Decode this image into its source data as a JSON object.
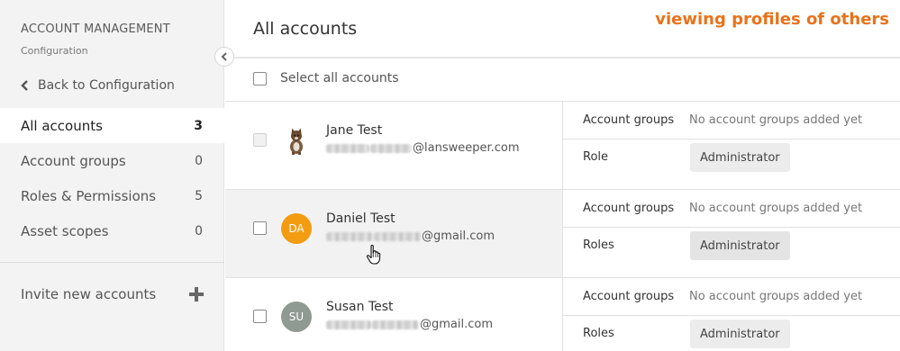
{
  "sidebar": {
    "title": "ACCOUNT MANAGEMENT",
    "subtitle": "Configuration",
    "back_label": "Back to Configuration",
    "items": [
      {
        "label": "All accounts",
        "count": "3",
        "active": true
      },
      {
        "label": "Account groups",
        "count": "0",
        "active": false
      },
      {
        "label": "Roles & Permissions",
        "count": "5",
        "active": false
      },
      {
        "label": "Asset scopes",
        "count": "0",
        "active": false
      }
    ],
    "invite_label": "Invite new accounts"
  },
  "main": {
    "title": "All accounts",
    "annotation": "viewing profiles of others",
    "select_all_label": "Select all accounts",
    "accounts": [
      {
        "name": "Jane Test",
        "email_domain": "@lansweeper.com",
        "avatar": "cat-photo",
        "initials": "",
        "avatar_color": "",
        "checkbox_disabled": true,
        "groups_label": "Account groups",
        "groups_value": "No account groups added yet",
        "role_label": "Role",
        "role_value": "Administrator"
      },
      {
        "name": "Daniel Test",
        "email_domain": "@gmail.com",
        "avatar": "initials",
        "initials": "DA",
        "avatar_color": "#f39c12",
        "checkbox_disabled": false,
        "groups_label": "Account groups",
        "groups_value": "No account groups added yet",
        "role_label": "Roles",
        "role_value": "Administrator"
      },
      {
        "name": "Susan Test",
        "email_domain": "@gmail.com",
        "avatar": "initials",
        "initials": "SU",
        "avatar_color": "#8f9a92",
        "checkbox_disabled": false,
        "groups_label": "Account groups",
        "groups_value": "No account groups added yet",
        "role_label": "Roles",
        "role_value": "Administrator"
      }
    ]
  },
  "colors": {
    "annotation": "#e8731b",
    "sidebar_bg": "#f3f3f3",
    "hover_row_bg": "#f2f2f2"
  },
  "icons": [
    "chevron-left-icon",
    "collapse-icon",
    "plus-icon",
    "hand-cursor-icon"
  ]
}
